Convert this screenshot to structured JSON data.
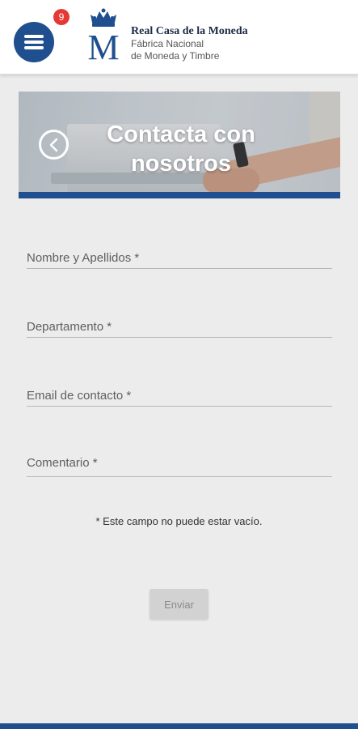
{
  "header": {
    "notification_count": "9",
    "brand_title": "Real Casa de la Moneda",
    "brand_line1": "Fábrica Nacional",
    "brand_line2": "de Moneda y Timbre",
    "logo_letter": "M"
  },
  "banner": {
    "title": "Contacta con nosotros"
  },
  "form": {
    "name_placeholder": "Nombre y Apellidos *",
    "department_placeholder": "Departamento *",
    "email_placeholder": "Email de contacto *",
    "comment_placeholder": "Comentario *",
    "error_message": "* Este campo no puede estar vacío.",
    "submit_label": "Enviar"
  },
  "colors": {
    "brand_blue": "#1f4f8f",
    "badge_red": "#e53935",
    "background": "#ececec"
  },
  "icons": [
    "menu-icon",
    "crown-icon",
    "back-arrow-icon"
  ]
}
